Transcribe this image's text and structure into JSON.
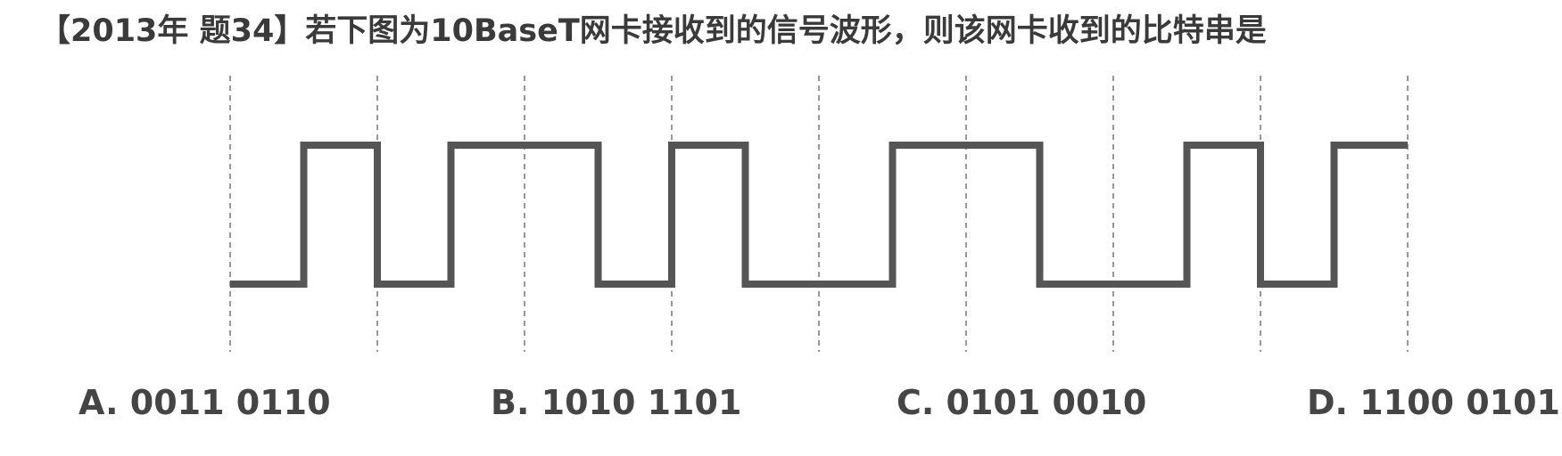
{
  "question": {
    "title": "【2013年 题34】若下图为10BaseT网卡接收到的信号波形，则该网卡收到的比特串是"
  },
  "waveform": {
    "encoding": "Manchester",
    "bit_periods": 8,
    "levels_per_half_bit": [
      0,
      1,
      0,
      1,
      1,
      0,
      1,
      0,
      0,
      1,
      1,
      0,
      0,
      1,
      0,
      1
    ],
    "line_color": "#555555",
    "guide_color": "#777777"
  },
  "options": [
    {
      "label": "A. 0011 0110"
    },
    {
      "label": "B. 1010 1101"
    },
    {
      "label": "C. 0101 0010"
    },
    {
      "label": "D. 1100 0101"
    }
  ]
}
